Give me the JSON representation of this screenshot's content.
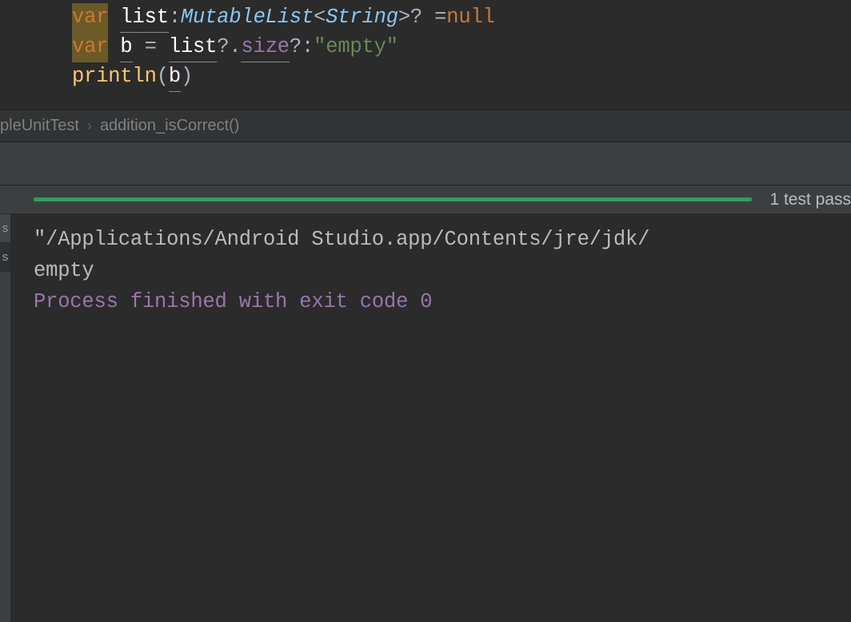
{
  "editor": {
    "lines": [
      {
        "tokens": [
          {
            "cls": "kw-var-hl",
            "t": "var"
          },
          {
            "cls": "op",
            "t": " "
          },
          {
            "cls": "ident-u",
            "t": "list"
          },
          {
            "cls": "op",
            "t": ":"
          },
          {
            "cls": "type-ital",
            "t": "MutableList"
          },
          {
            "cls": "op",
            "t": "<"
          },
          {
            "cls": "type-ital",
            "t": "String"
          },
          {
            "cls": "op",
            "t": ">? ="
          },
          {
            "cls": "kw-null",
            "t": "null"
          }
        ]
      },
      {
        "tokens": [
          {
            "cls": "kw-var-hl",
            "t": "var"
          },
          {
            "cls": "op",
            "t": " "
          },
          {
            "cls": "ident-u",
            "t": "b"
          },
          {
            "cls": "op",
            "t": " = "
          },
          {
            "cls": "ident-u",
            "t": "list"
          },
          {
            "cls": "op",
            "t": "?."
          },
          {
            "cls": "size",
            "t": "size"
          },
          {
            "cls": "op",
            "t": "?:"
          },
          {
            "cls": "str",
            "t": "\"empty\""
          }
        ]
      },
      {
        "tokens": [
          {
            "cls": "fn",
            "t": "println"
          },
          {
            "cls": "paren",
            "t": "("
          },
          {
            "cls": "ident-u",
            "t": "b"
          },
          {
            "cls": "paren",
            "t": ")"
          }
        ]
      }
    ]
  },
  "breadcrumb": {
    "part1": "pleUnitTest",
    "part2": "addition_isCorrect()"
  },
  "progress": {
    "label": "1 test pass"
  },
  "sideStubs": [
    "s",
    "s"
  ],
  "console": {
    "line1": "\"/Applications/Android Studio.app/Contents/jre/jdk/",
    "line2": "empty",
    "line3": "",
    "line4": "Process finished with exit code 0"
  }
}
